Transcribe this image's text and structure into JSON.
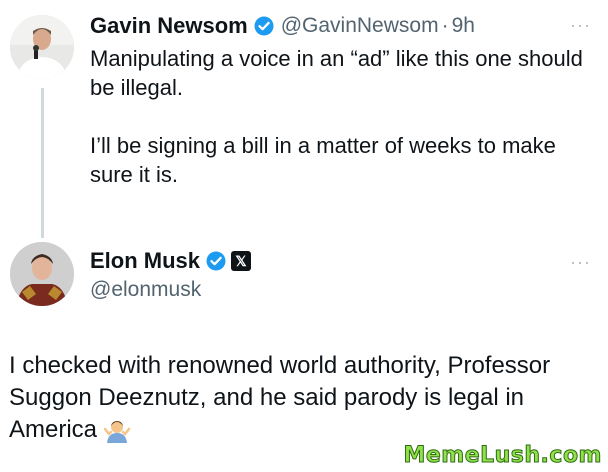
{
  "tweet1": {
    "name": "Gavin Newsom",
    "handle": "@GavinNewsom",
    "separator": "·",
    "time": "9h",
    "more": "···",
    "paragraphs": [
      "Manipulating a voice in an “ad” like this one should be illegal.",
      "I’ll be signing a bill in a matter of weeks to make sure it is."
    ],
    "verified_color": "#1d9bf0"
  },
  "tweet2": {
    "name": "Elon Musk",
    "handle": "@elonmusk",
    "affiliate_badge": "𝕏",
    "more": "···",
    "text": "I checked with renowned world authority, Professor Suggon Deeznutz, and he said parody is legal in America",
    "emoji": "person-shrugging-icon",
    "verified_color": "#1d9bf0"
  },
  "watermark": "MemeLush.com"
}
